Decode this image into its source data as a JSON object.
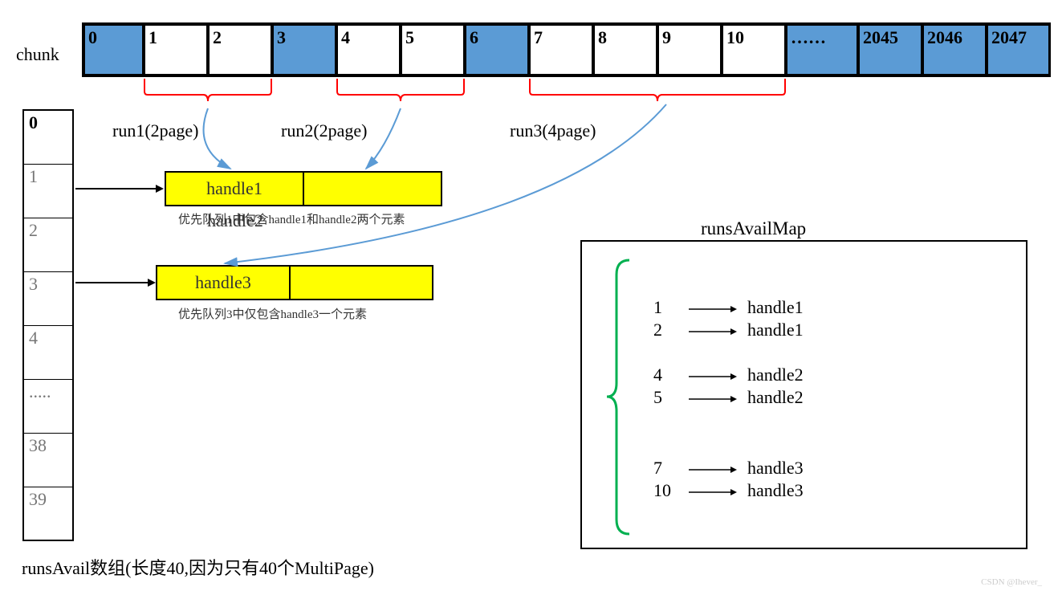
{
  "chunk_label": "chunk",
  "chunk_cells": [
    {
      "v": "0",
      "blue": true
    },
    {
      "v": "1",
      "blue": false
    },
    {
      "v": "2",
      "blue": false
    },
    {
      "v": "3",
      "blue": true
    },
    {
      "v": "4",
      "blue": false
    },
    {
      "v": "5",
      "blue": false
    },
    {
      "v": "6",
      "blue": true
    },
    {
      "v": "7",
      "blue": false
    },
    {
      "v": "8",
      "blue": false
    },
    {
      "v": "9",
      "blue": false
    },
    {
      "v": "10",
      "blue": false
    },
    {
      "v": "……",
      "blue": true
    },
    {
      "v": "2045",
      "blue": true
    },
    {
      "v": "2046",
      "blue": true
    },
    {
      "v": "2047",
      "blue": true
    }
  ],
  "runs": {
    "r1": "run1(2page)",
    "r2": "run2(2page)",
    "r3": "run3(4page)"
  },
  "array_cells": [
    {
      "v": "0",
      "bold": true
    },
    {
      "v": "1"
    },
    {
      "v": "2"
    },
    {
      "v": "3"
    },
    {
      "v": "4"
    },
    {
      "v": "....."
    },
    {
      "v": "38"
    },
    {
      "v": "39"
    }
  ],
  "queues": {
    "q1": {
      "handle1": "handle1",
      "handle2": "handle2",
      "caption": "优先队列1中包含handle1和handle2两个元素"
    },
    "q2": {
      "handle3": "handle3",
      "caption": "优先队列3中仅包含handle3一个元素"
    }
  },
  "runsAvailMap_label": "runsAvailMap",
  "map_entries": [
    {
      "k": "1",
      "v": "handle1"
    },
    {
      "k": "2",
      "v": "handle1"
    },
    {
      "k": "4",
      "v": "handle2"
    },
    {
      "k": "5",
      "v": "handle2"
    },
    {
      "k": "7",
      "v": "handle3"
    },
    {
      "k": "10",
      "v": "handle3"
    }
  ],
  "bottom_label": "runsAvail数组(长度40,因为只有40个MultiPage)",
  "watermark": "CSDN @Ihever_",
  "chart_data": {
    "type": "diagram",
    "description": "Memory chunk allocation diagram showing a chunk array of 2048 pages with runs of free pages managed by a runsAvail array (length 40) of priority queues and a runsAvailMap mapping page indices to handles.",
    "chunk": {
      "pages_total": 2048,
      "allocated_indices": [
        0,
        3,
        6,
        "...",
        2045,
        2046,
        2047
      ],
      "free_runs": [
        {
          "name": "run1",
          "start": 1,
          "length": 2
        },
        {
          "name": "run2",
          "start": 4,
          "length": 2
        },
        {
          "name": "run3",
          "start": 7,
          "length": 4
        }
      ]
    },
    "runsAvail": {
      "length": 40,
      "bucket_1": [
        "handle1",
        "handle2"
      ],
      "bucket_3": [
        "handle3"
      ]
    },
    "runsAvailMap": {
      "1": "handle1",
      "2": "handle1",
      "4": "handle2",
      "5": "handle2",
      "7": "handle3",
      "10": "handle3"
    }
  }
}
